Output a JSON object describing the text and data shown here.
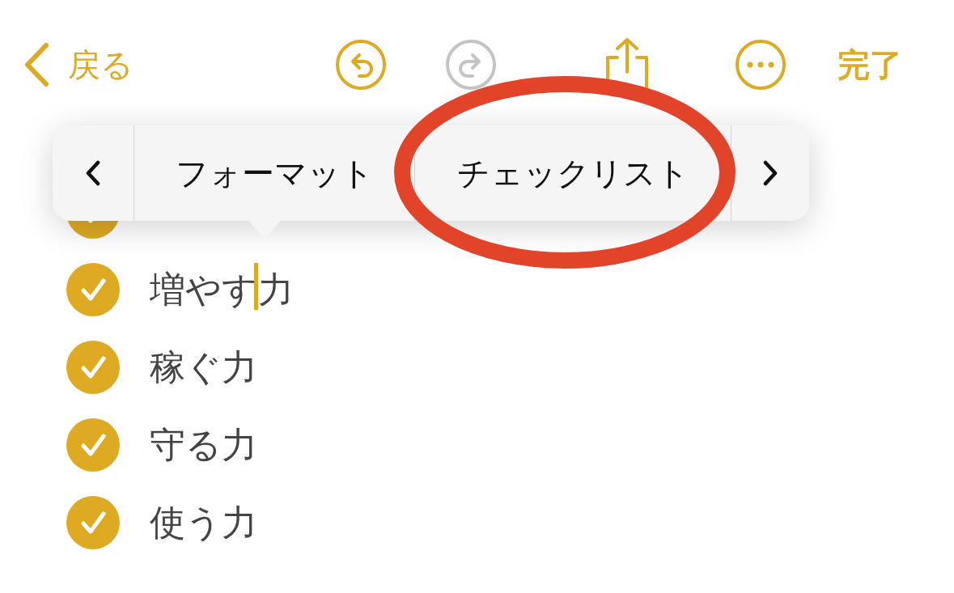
{
  "toolbar": {
    "back": {
      "label": "戻る"
    },
    "undo": {
      "disabled": false
    },
    "redo": {
      "disabled": true
    },
    "done": {
      "label": "完了"
    }
  },
  "menu": {
    "items": [
      {
        "label": "フォーマット",
        "annotated": false
      },
      {
        "label": "チェックリスト",
        "annotated": true
      }
    ]
  },
  "checklist": [
    {
      "checked": true
    },
    {
      "label": "増やす力",
      "checked": true,
      "cursor": true
    },
    {
      "label": "稼ぐ力",
      "checked": true,
      "cursor": false
    },
    {
      "label": "守る力",
      "checked": true,
      "cursor": false
    },
    {
      "label": "使う力",
      "checked": true,
      "cursor": false
    }
  ]
}
